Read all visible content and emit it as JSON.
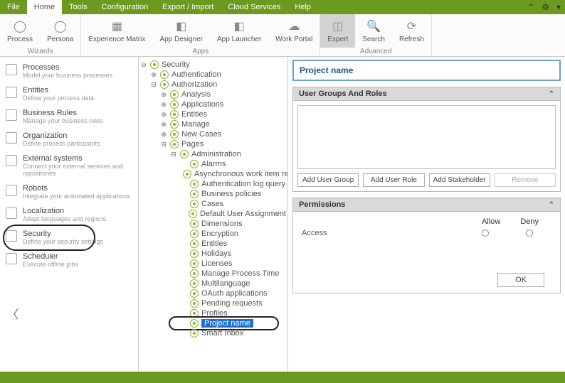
{
  "menu": {
    "items": [
      "File",
      "Home",
      "Tools",
      "Configuration",
      "Export / Import",
      "Cloud Services",
      "Help"
    ],
    "active": 1
  },
  "ribbon": {
    "groups": [
      {
        "label": "Wizards",
        "items": [
          {
            "label": "Process",
            "icon": "◯"
          },
          {
            "label": "Persona",
            "icon": "◯"
          }
        ]
      },
      {
        "label": "Apps",
        "items": [
          {
            "label": "Experience Matrix",
            "icon": "▦"
          },
          {
            "label": "App Designer",
            "icon": "◧"
          },
          {
            "label": "App Launcher",
            "icon": "◧"
          },
          {
            "label": "Work Portal",
            "icon": "☁"
          }
        ]
      },
      {
        "label": "Advanced",
        "items": [
          {
            "label": "Expert",
            "icon": "◫",
            "selected": true
          },
          {
            "label": "Search",
            "icon": "🔍"
          },
          {
            "label": "Refresh",
            "icon": "⟳"
          }
        ]
      }
    ]
  },
  "sidebar": {
    "items": [
      {
        "title": "Processes",
        "desc": "Model your business processes"
      },
      {
        "title": "Entities",
        "desc": "Define your process data"
      },
      {
        "title": "Business Rules",
        "desc": "Manage your business rules"
      },
      {
        "title": "Organization",
        "desc": "Define process participants"
      },
      {
        "title": "External systems",
        "desc": "Connect your external services and repositories"
      },
      {
        "title": "Robots",
        "desc": "Integrate your automated applications"
      },
      {
        "title": "Localization",
        "desc": "Adapt languages and regions"
      },
      {
        "title": "Security",
        "desc": "Define your security settings",
        "selected": true
      },
      {
        "title": "Scheduler",
        "desc": "Execute offline jobs"
      }
    ]
  },
  "tree": {
    "root": "Security",
    "nodes": [
      {
        "d": 1,
        "t": "⊕",
        "l": "Authentication"
      },
      {
        "d": 1,
        "t": "⊟",
        "l": "Authorization"
      },
      {
        "d": 2,
        "t": "⊕",
        "l": "Analysis"
      },
      {
        "d": 2,
        "t": "⊕",
        "l": "Applications"
      },
      {
        "d": 2,
        "t": "⊕",
        "l": "Entities"
      },
      {
        "d": 2,
        "t": "⊕",
        "l": "Manage"
      },
      {
        "d": 2,
        "t": "⊕",
        "l": "New Cases"
      },
      {
        "d": 2,
        "t": "⊟",
        "l": "Pages"
      },
      {
        "d": 3,
        "t": "⊟",
        "l": "Administration"
      },
      {
        "d": 4,
        "t": "",
        "l": "Alarms"
      },
      {
        "d": 4,
        "t": "",
        "l": "Asynchronous work item retries"
      },
      {
        "d": 4,
        "t": "",
        "l": "Authentication log query"
      },
      {
        "d": 4,
        "t": "",
        "l": "Business policies"
      },
      {
        "d": 4,
        "t": "",
        "l": "Cases"
      },
      {
        "d": 4,
        "t": "",
        "l": "Default User Assignment"
      },
      {
        "d": 4,
        "t": "",
        "l": "Dimensions"
      },
      {
        "d": 4,
        "t": "",
        "l": "Encryption"
      },
      {
        "d": 4,
        "t": "",
        "l": "Entities"
      },
      {
        "d": 4,
        "t": "",
        "l": "Holidays"
      },
      {
        "d": 4,
        "t": "",
        "l": "Licenses"
      },
      {
        "d": 4,
        "t": "",
        "l": "Manage Process Time"
      },
      {
        "d": 4,
        "t": "",
        "l": "Multilanguage"
      },
      {
        "d": 4,
        "t": "",
        "l": "OAuth applications"
      },
      {
        "d": 4,
        "t": "",
        "l": "Pending requests"
      },
      {
        "d": 4,
        "t": "",
        "l": "Profiles"
      },
      {
        "d": 4,
        "t": "",
        "l": "Project name",
        "selected": true
      },
      {
        "d": 4,
        "t": "",
        "l": "Smart Inbox"
      }
    ]
  },
  "content": {
    "title": "Project name",
    "panel1": {
      "header": "User Groups And Roles",
      "buttons": [
        "Add User Group",
        "Add User Role",
        "Add Stakeholder",
        "Remove"
      ]
    },
    "panel2": {
      "header": "Permissions",
      "cols": [
        "Allow",
        "Deny"
      ],
      "rows": [
        "Access"
      ]
    },
    "ok": "OK"
  }
}
